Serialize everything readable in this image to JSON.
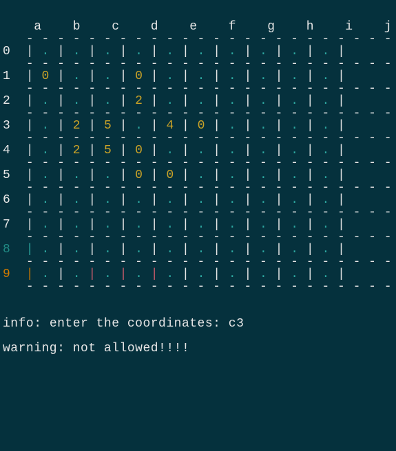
{
  "board": {
    "columns": [
      "a",
      "b",
      "c",
      "d",
      "e",
      "f",
      "g",
      "h",
      "i",
      "j"
    ],
    "rows_label": [
      "0",
      "1",
      "2",
      "3",
      "4",
      "5",
      "6",
      "7",
      "8",
      "9"
    ],
    "row_label_color": {
      "0": "white",
      "1": "white",
      "2": "white",
      "3": "white",
      "4": "white",
      "5": "white",
      "6": "white",
      "7": "white",
      "8": "teal-d",
      "9": "orange"
    },
    "divider": " - - - - - - - - - - - - - - - - - - - - - - - - - - -",
    "cells": {
      "0": [
        ".",
        ".",
        ".",
        ".",
        ".",
        ".",
        ".",
        ".",
        ".",
        "."
      ],
      "1": [
        "0",
        ".",
        ".",
        "0",
        ".",
        ".",
        ".",
        ".",
        ".",
        "."
      ],
      "2": [
        ".",
        ".",
        ".",
        "2",
        ".",
        ".",
        ".",
        ".",
        ".",
        "."
      ],
      "3": [
        ".",
        "2",
        "5",
        ".",
        "4",
        "0",
        ".",
        ".",
        ".",
        "."
      ],
      "4": [
        ".",
        "2",
        "5",
        "0",
        ".",
        ".",
        ".",
        ".",
        ".",
        "."
      ],
      "5": [
        ".",
        ".",
        ".",
        "0",
        "0",
        ".",
        ".",
        ".",
        ".",
        "."
      ],
      "6": [
        ".",
        ".",
        ".",
        ".",
        ".",
        ".",
        ".",
        ".",
        ".",
        "."
      ],
      "7": [
        ".",
        ".",
        ".",
        ".",
        ".",
        ".",
        ".",
        ".",
        ".",
        "."
      ],
      "8": [
        ".",
        ".",
        ".",
        ".",
        ".",
        ".",
        ".",
        ".",
        ".",
        "."
      ],
      "9": [
        ".",
        ".",
        ".",
        ".",
        ".",
        ".",
        ".",
        ".",
        ".",
        "."
      ]
    },
    "cell_color": {
      "0": [
        "teal",
        "teal",
        "teal",
        "teal",
        "teal",
        "teal",
        "teal",
        "teal",
        "teal",
        "teal"
      ],
      "1": [
        "yellow",
        "teal",
        "teal",
        "yellow",
        "teal",
        "teal",
        "teal",
        "teal",
        "teal",
        "teal"
      ],
      "2": [
        "teal",
        "teal",
        "teal",
        "yellow",
        "teal",
        "teal",
        "teal",
        "teal",
        "teal",
        "teal"
      ],
      "3": [
        "teal",
        "yellow",
        "yellow",
        "teal",
        "yellow",
        "yellow",
        "teal",
        "teal",
        "teal",
        "teal"
      ],
      "4": [
        "teal",
        "yellow",
        "yellow",
        "yellow",
        "teal",
        "teal",
        "teal",
        "teal",
        "teal",
        "teal"
      ],
      "5": [
        "teal",
        "teal",
        "teal",
        "yellow",
        "yellow",
        "teal",
        "teal",
        "teal",
        "teal",
        "teal"
      ],
      "6": [
        "teal",
        "teal",
        "teal",
        "teal",
        "teal",
        "teal",
        "teal",
        "teal",
        "teal",
        "teal"
      ],
      "7": [
        "teal",
        "teal",
        "teal",
        "teal",
        "teal",
        "teal",
        "teal",
        "teal",
        "teal",
        "teal"
      ],
      "8": [
        "teal",
        "teal",
        "teal",
        "teal",
        "teal",
        "teal",
        "teal",
        "teal",
        "teal",
        "teal"
      ],
      "9": [
        "teal",
        "teal",
        "teal",
        "teal",
        "teal",
        "teal",
        "teal",
        "teal",
        "teal",
        "teal"
      ]
    },
    "bar_color": {
      "0": [
        "white",
        "white",
        "white",
        "white",
        "white",
        "white",
        "white",
        "white",
        "white",
        "white",
        "white"
      ],
      "1": [
        "white",
        "white",
        "white",
        "white",
        "white",
        "white",
        "white",
        "white",
        "white",
        "white",
        "white"
      ],
      "2": [
        "white",
        "white",
        "white",
        "white",
        "white",
        "white",
        "white",
        "white",
        "white",
        "white",
        "white"
      ],
      "3": [
        "white",
        "white",
        "white",
        "white",
        "white",
        "white",
        "white",
        "white",
        "white",
        "white",
        "white"
      ],
      "4": [
        "white",
        "white",
        "white",
        "white",
        "white",
        "white",
        "white",
        "white",
        "white",
        "white",
        "white"
      ],
      "5": [
        "white",
        "white",
        "white",
        "white",
        "white",
        "white",
        "white",
        "white",
        "white",
        "white",
        "white"
      ],
      "6": [
        "white",
        "white",
        "white",
        "white",
        "white",
        "white",
        "white",
        "white",
        "white",
        "white",
        "white"
      ],
      "7": [
        "white",
        "white",
        "white",
        "white",
        "white",
        "white",
        "white",
        "white",
        "white",
        "white",
        "white"
      ],
      "8": [
        "teal",
        "white",
        "white",
        "white",
        "white",
        "white",
        "white",
        "white",
        "white",
        "white",
        "white"
      ],
      "9": [
        "orange",
        "white",
        "pink",
        "pink",
        "pink",
        "white",
        "white",
        "white",
        "white",
        "white",
        "white"
      ]
    }
  },
  "messages": {
    "info_label": "info:",
    "info_text": " enter the coordinates: ",
    "info_input": "c3",
    "warning_label": "warning:",
    "warning_text": " not allowed!!!!"
  },
  "glyphs": {
    "bar": "|",
    "dot": "."
  }
}
